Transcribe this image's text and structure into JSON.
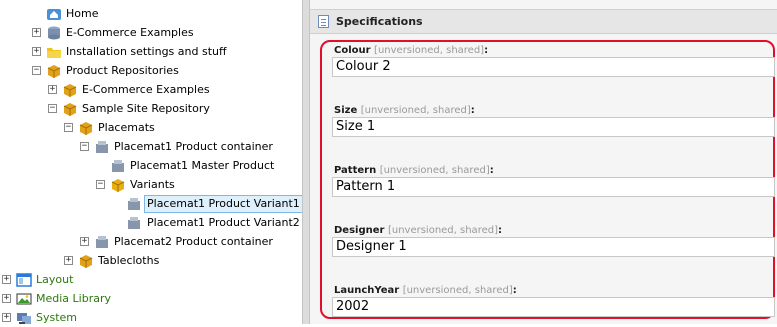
{
  "tree": {
    "home": "Home",
    "ecommerce_examples": "E-Commerce Examples",
    "installation": "Installation settings and stuff",
    "product_repositories": "Product Repositories",
    "pr_ecommerce_examples": "E-Commerce Examples",
    "sample_site_repository": "Sample Site Repository",
    "placemats": "Placemats",
    "placemat1_container": "Placemat1 Product container",
    "placemat1_master": "Placemat1 Master Product",
    "variants": "Variants",
    "variant1": "Placemat1 Product Variant1",
    "variant2": "Placemat1 Product Variant2",
    "placemat2_container": "Placemat2 Product container",
    "tablecloths": "Tablecloths",
    "layout": "Layout",
    "media_library": "Media Library",
    "system": "System"
  },
  "section": {
    "title": "Specifications"
  },
  "fields": [
    {
      "name": "Colour",
      "meta": "[unversioned, shared]",
      "value": "Colour 2"
    },
    {
      "name": "Size",
      "meta": "[unversioned, shared]",
      "value": "Size 1"
    },
    {
      "name": "Pattern",
      "meta": "[unversioned, shared]",
      "value": "Pattern 1"
    },
    {
      "name": "Designer",
      "meta": "[unversioned, shared]",
      "value": "Designer 1"
    },
    {
      "name": "LaunchYear",
      "meta": "[unversioned, shared]",
      "value": "2002"
    }
  ],
  "colors": {
    "highlight": "#e0102a",
    "selection": "#dff0fd",
    "green_text": "#2b7a0b"
  }
}
